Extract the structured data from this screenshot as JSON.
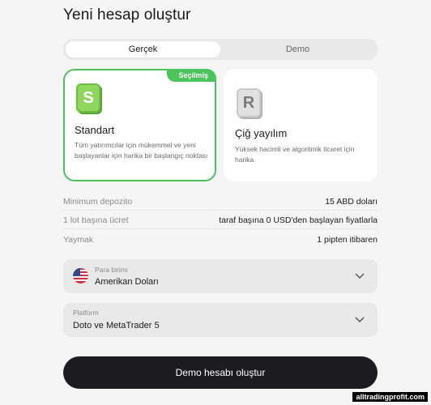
{
  "header": {
    "title": "Yeni hesap oluştur"
  },
  "tabs": [
    {
      "label": "Gerçek",
      "active": true
    },
    {
      "label": "Demo",
      "active": false
    }
  ],
  "accounts": [
    {
      "icon_letter": "S",
      "icon": "s-account-icon",
      "badge": "Seçilmiş",
      "title": "Standart",
      "description": "Tüm yatırımcılar için mükemmel ve yeni başlayanlar için harika bir başlangıç noktası",
      "selected": true
    },
    {
      "icon_letter": "R",
      "icon": "r-account-icon",
      "title": "Çiğ yayılım",
      "description": "Yüksek hacimli ve algoritmik ticaret için harika",
      "selected": false
    }
  ],
  "info": [
    {
      "label": "Minimum depozito",
      "value": "15 ABD doları"
    },
    {
      "label": "1 lot başına ücret",
      "value": "taraf başına 0 USD'den başlayan fiyatlarla"
    },
    {
      "label": "Yaymak",
      "value": "1 pipten itibaren"
    }
  ],
  "currency": {
    "label": "Para birimi",
    "value": "Amerikan Doları",
    "flag": "us-flag-icon"
  },
  "platform": {
    "label": "Platform",
    "value": "Doto ve MetaTrader 5"
  },
  "cta": {
    "label": "Demo hesabı oluştur"
  },
  "watermark": "alltradingprofit.com",
  "colors": {
    "accent_green": "#4cc45c",
    "cta_bg": "#1c1c1e",
    "background": "#f5f5f5"
  }
}
